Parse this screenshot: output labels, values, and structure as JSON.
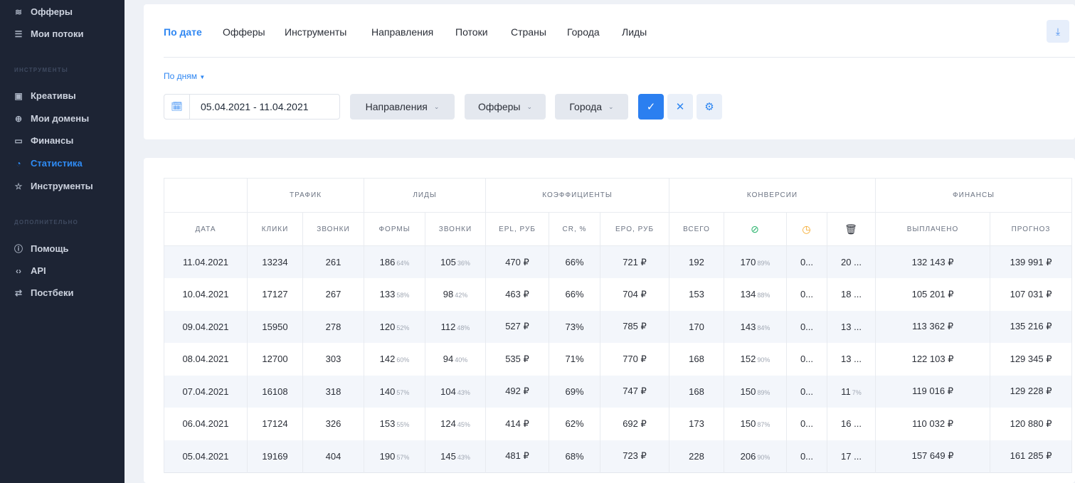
{
  "sidebar": {
    "items_top": [
      {
        "label": "Офферы",
        "icon": "layers-icon"
      },
      {
        "label": "Мои потоки",
        "icon": "list-icon"
      }
    ],
    "section_tools": "ИНСТРУМЕНТЫ",
    "items_tools": [
      {
        "label": "Креативы",
        "icon": "image-icon"
      },
      {
        "label": "Мои домены",
        "icon": "globe-icon"
      },
      {
        "label": "Финансы",
        "icon": "wallet-icon"
      },
      {
        "label": "Статистика",
        "icon": "pie-chart-icon",
        "active": true
      },
      {
        "label": "Инструменты",
        "icon": "star-icon"
      }
    ],
    "section_extra": "ДОПОЛНИТЕЛЬНО",
    "items_extra": [
      {
        "label": "Помощь",
        "icon": "help-icon"
      },
      {
        "label": "API",
        "icon": "code-icon"
      },
      {
        "label": "Постбеки",
        "icon": "swap-icon"
      }
    ]
  },
  "tabs": [
    "По дате",
    "Офферы",
    "Инструменты",
    "Направления",
    "Потоки",
    "Страны",
    "Города",
    "Лиды"
  ],
  "filters": {
    "period": "По дням",
    "date_range": "05.04.2021 - 11.04.2021",
    "directions": "Направления",
    "offers": "Офферы",
    "cities": "Города"
  },
  "colors": {
    "accent": "#2e86f2",
    "sidebar_bg": "#1d2434",
    "ok": "#27b36b",
    "pending": "#f5a623"
  },
  "table": {
    "groups": {
      "traffic": "ТРАФИК",
      "leads": "ЛИДЫ",
      "coefficients": "КОЭФФИЦИЕНТЫ",
      "conversions": "КОНВЕРСИИ",
      "finance": "ФИНАНСЫ"
    },
    "columns": {
      "date": "ДАТА",
      "clicks": "КЛИКИ",
      "calls": "ЗВОНКИ",
      "forms": "ФОРМЫ",
      "lead_calls": "ЗВОНКИ",
      "epl": "EPL, РУБ",
      "cr": "CR, %",
      "epo": "EPO, РУБ",
      "total": "ВСЕГО",
      "paid": "ВЫПЛАЧЕНО",
      "forecast": "ПРОГНОЗ"
    },
    "rows": [
      {
        "date": "11.04.2021",
        "clicks": "13234",
        "calls": "261",
        "forms": "186",
        "forms_pct": "64%",
        "lcalls": "105",
        "lcalls_pct": "36%",
        "epl": "470 ₽",
        "cr": "66%",
        "epo": "721 ₽",
        "total": "192",
        "approved": "170",
        "approved_pct": "89%",
        "pending": "0...",
        "rejected": "20 ...",
        "rejected_pct": "",
        "paid": "132 143 ₽",
        "forecast": "139 991 ₽"
      },
      {
        "date": "10.04.2021",
        "clicks": "17127",
        "calls": "267",
        "forms": "133",
        "forms_pct": "58%",
        "lcalls": "98",
        "lcalls_pct": "42%",
        "epl": "463 ₽",
        "cr": "66%",
        "epo": "704 ₽",
        "total": "153",
        "approved": "134",
        "approved_pct": "88%",
        "pending": "0...",
        "rejected": "18 ...",
        "rejected_pct": "",
        "paid": "105 201 ₽",
        "forecast": "107 031 ₽"
      },
      {
        "date": "09.04.2021",
        "clicks": "15950",
        "calls": "278",
        "forms": "120",
        "forms_pct": "52%",
        "lcalls": "112",
        "lcalls_pct": "48%",
        "epl": "527 ₽",
        "cr": "73%",
        "epo": "785 ₽",
        "total": "170",
        "approved": "143",
        "approved_pct": "84%",
        "pending": "0...",
        "rejected": "13 ...",
        "rejected_pct": "",
        "paid": "113 362 ₽",
        "forecast": "135 216 ₽"
      },
      {
        "date": "08.04.2021",
        "clicks": "12700",
        "calls": "303",
        "forms": "142",
        "forms_pct": "60%",
        "lcalls": "94",
        "lcalls_pct": "40%",
        "epl": "535 ₽",
        "cr": "71%",
        "epo": "770 ₽",
        "total": "168",
        "approved": "152",
        "approved_pct": "90%",
        "pending": "0...",
        "rejected": "13 ...",
        "rejected_pct": "",
        "paid": "122 103 ₽",
        "forecast": "129 345 ₽"
      },
      {
        "date": "07.04.2021",
        "clicks": "16108",
        "calls": "318",
        "forms": "140",
        "forms_pct": "57%",
        "lcalls": "104",
        "lcalls_pct": "43%",
        "epl": "492 ₽",
        "cr": "69%",
        "epo": "747 ₽",
        "total": "168",
        "approved": "150",
        "approved_pct": "89%",
        "pending": "0...",
        "rejected": "11",
        "rejected_pct": "7%",
        "paid": "119 016 ₽",
        "forecast": "129 228 ₽"
      },
      {
        "date": "06.04.2021",
        "clicks": "17124",
        "calls": "326",
        "forms": "153",
        "forms_pct": "55%",
        "lcalls": "124",
        "lcalls_pct": "45%",
        "epl": "414 ₽",
        "cr": "62%",
        "epo": "692 ₽",
        "total": "173",
        "approved": "150",
        "approved_pct": "87%",
        "pending": "0...",
        "rejected": "16 ...",
        "rejected_pct": "",
        "paid": "110 032 ₽",
        "forecast": "120 880 ₽"
      },
      {
        "date": "05.04.2021",
        "clicks": "19169",
        "calls": "404",
        "forms": "190",
        "forms_pct": "57%",
        "lcalls": "145",
        "lcalls_pct": "43%",
        "epl": "481 ₽",
        "cr": "68%",
        "epo": "723 ₽",
        "total": "228",
        "approved": "206",
        "approved_pct": "90%",
        "pending": "0...",
        "rejected": "17 ...",
        "rejected_pct": "",
        "paid": "157 649 ₽",
        "forecast": "161 285 ₽"
      }
    ]
  }
}
